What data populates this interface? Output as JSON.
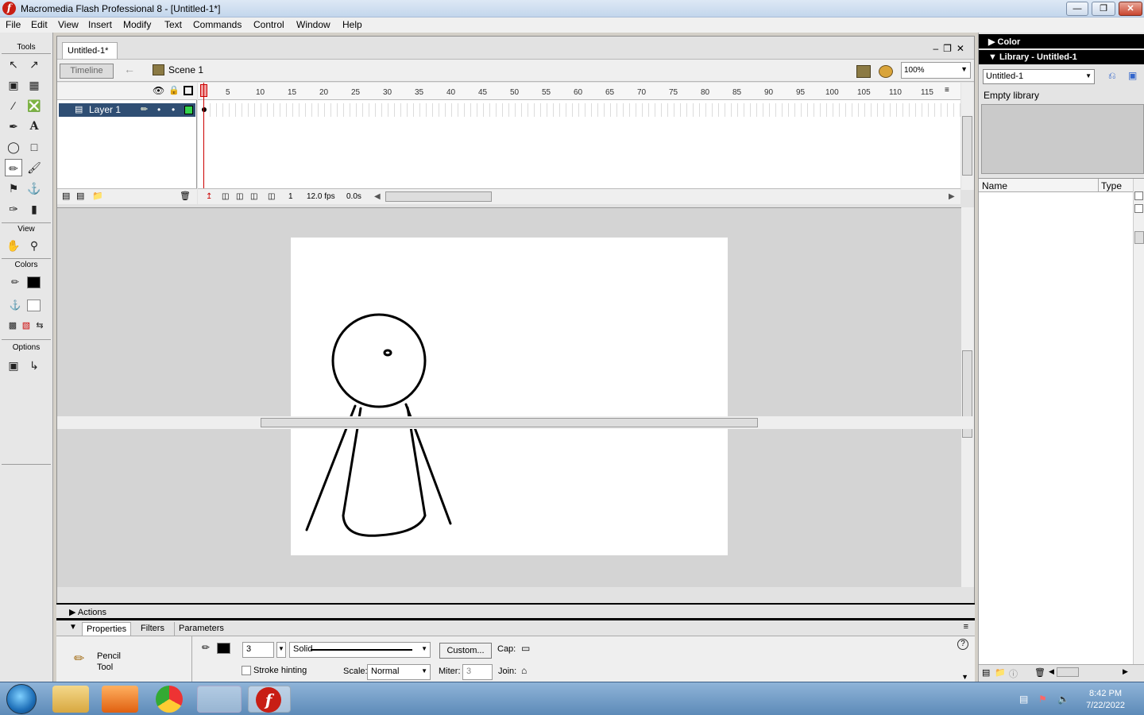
{
  "window": {
    "title": "Macromedia Flash Professional 8 - [Untitled-1*]"
  },
  "menubar": [
    "File",
    "Edit",
    "View",
    "Insert",
    "Modify",
    "Text",
    "Commands",
    "Control",
    "Window",
    "Help"
  ],
  "tools": {
    "section_tools": "Tools",
    "section_view": "View",
    "section_colors": "Colors",
    "section_options": "Options"
  },
  "document": {
    "tab": "Untitled-1*",
    "timeline_button": "Timeline",
    "scene": "Scene 1",
    "zoom": "100%"
  },
  "timeline": {
    "layer_name": "Layer 1",
    "ruler": [
      "5",
      "10",
      "15",
      "20",
      "25",
      "30",
      "35",
      "40",
      "45",
      "50",
      "55",
      "60",
      "65",
      "70",
      "75",
      "80",
      "85",
      "90",
      "95",
      "100",
      "105",
      "110",
      "115"
    ],
    "current_frame": "1",
    "frame_rate": "12.0 fps",
    "elapsed": "0.0s"
  },
  "panels": {
    "actions": "Actions",
    "tabs": [
      "Properties",
      "Filters",
      "Parameters"
    ],
    "tool_name_line1": "Pencil",
    "tool_name_line2": "Tool",
    "stroke_width": "3",
    "stroke_style": "Solid",
    "custom_button": "Custom...",
    "cap_label": "Cap:",
    "stroke_hinting": "Stroke hinting",
    "scale_label": "Scale:",
    "scale_value": "Normal",
    "miter_label": "Miter:",
    "miter_value": "3",
    "join_label": "Join:",
    "help": "?"
  },
  "right": {
    "color_title": "Color",
    "library_title": "Library - Untitled-1",
    "library_select": "Untitled-1",
    "library_status": "Empty library",
    "col_name": "Name",
    "col_type": "Type"
  },
  "taskbar": {
    "time": "8:42 PM",
    "date": "7/22/2022"
  },
  "colors": {
    "selected_layer": "#2f4e73",
    "playhead": "#cc0000",
    "stage": "#ffffff",
    "stroke": "#000000"
  }
}
